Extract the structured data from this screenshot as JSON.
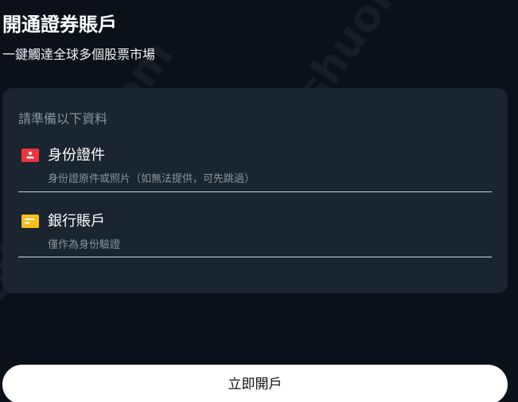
{
  "header": {
    "title": "開通證券賬戶",
    "subtitle": "一鍵觸達全球多個股票市場"
  },
  "requirements": {
    "heading": "請準備以下資料",
    "items": [
      {
        "title": "身份證件",
        "description": "身份證原件或照片（如無法提供，可先跳過）",
        "icon": "id-card-icon",
        "icon_color": "#e8363a"
      },
      {
        "title": "銀行賬戶",
        "description": "僅作為身份驗證",
        "icon": "bank-card-icon",
        "icon_color": "#f5bd1f"
      }
    ]
  },
  "actions": {
    "open_account_label": "立即開戶"
  },
  "watermark": {
    "text": "ttshuoka.com"
  },
  "colors": {
    "background": "#0a1119",
    "card": "#1b252f",
    "muted_text": "#8a949e",
    "button_bg": "#ffffff"
  }
}
